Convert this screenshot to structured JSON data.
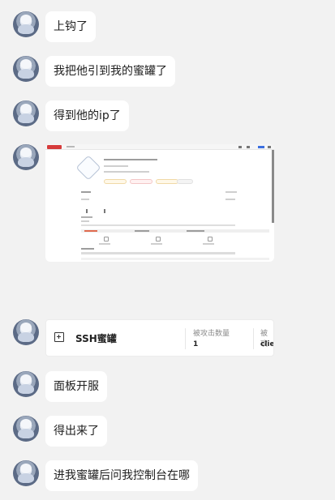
{
  "messages": [
    {
      "text": "上钩了"
    },
    {
      "text": "我把他引到我的蜜罐了"
    },
    {
      "text": "得到他的ip了"
    },
    {
      "text": "面板开服"
    },
    {
      "text": "得出来了"
    },
    {
      "text": "进我蜜罐后问我控制台在哪"
    }
  ],
  "card": {
    "name": "SSH蜜罐",
    "col1_label": "被攻击数量",
    "col1_value": "1",
    "col2_label": "被攻",
    "col2_value": "clie"
  }
}
